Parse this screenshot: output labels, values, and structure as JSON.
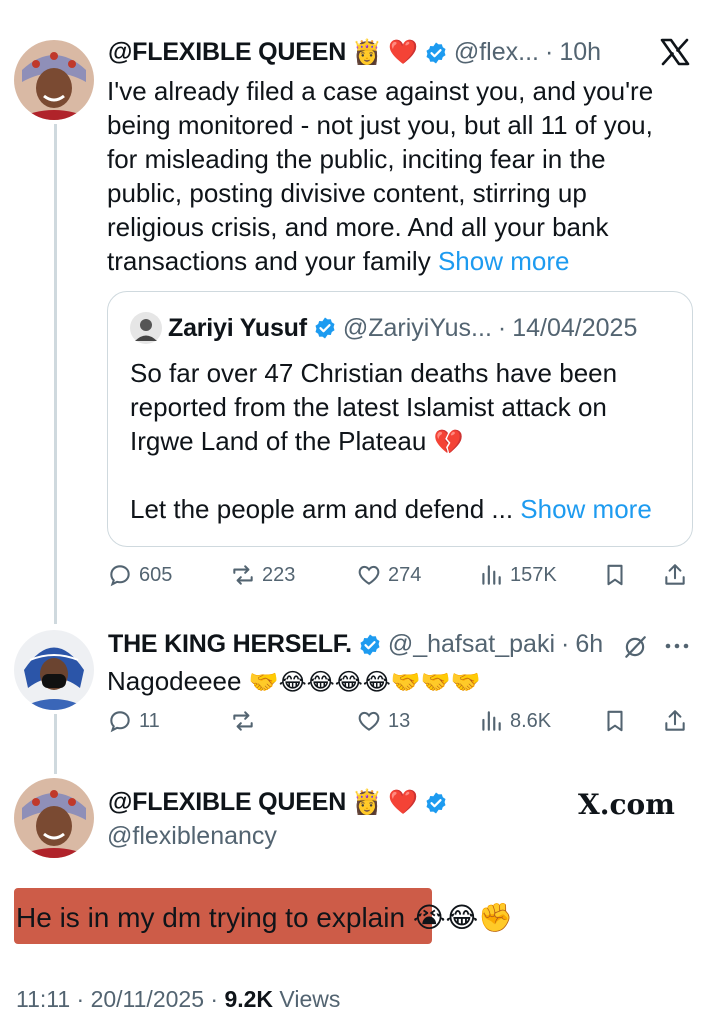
{
  "tweet1": {
    "display_name": "@FLEXIBLE QUEEN",
    "handle": "@flex...",
    "sep": "·",
    "time": "10h",
    "body": "I've already filed a case against you, and you're being monitored - not just you, but all 11 of you, for misleading the public, inciting fear in the public, posting divisive content, stirring up religious crisis, and more. And all your bank transactions and your family",
    "show_more": "Show more",
    "quote": {
      "display_name": "Zariyi Yusuf",
      "handle": "@ZariyiYus...",
      "sep": "·",
      "date": "14/04/2025",
      "body": "So far over 47 Christian deaths have been reported from the latest Islamist attack on Irgwe Land of the Plateau",
      "body2": "Let the people arm and defend ...",
      "show_more": "Show more"
    },
    "metrics": {
      "replies": "605",
      "reposts": "223",
      "likes": "274",
      "views": "157K"
    }
  },
  "tweet2": {
    "display_name": "THE KING HERSELF.",
    "handle": "@_hafsat_paki",
    "sep": "·",
    "time": "6h",
    "body": "Nagodeeee",
    "metrics": {
      "replies": "11",
      "reposts": "",
      "likes": "13",
      "views": "8.6K"
    }
  },
  "tweet3": {
    "display_name": "@FLEXIBLE QUEEN",
    "handle": "@flexiblenancy",
    "watermark": "X.com",
    "body": "He is in my dm trying to explain",
    "timestamp": "11:11 · 20/11/2025 · ",
    "views_count": "9.2K",
    "views_label": " Views"
  },
  "icons": {
    "verified": "verified-badge-icon",
    "x_logo": "x-logo-icon",
    "colors": {
      "blue": "#1d9bf0",
      "grey": "#536471",
      "highlight": "#cd5c48"
    }
  }
}
